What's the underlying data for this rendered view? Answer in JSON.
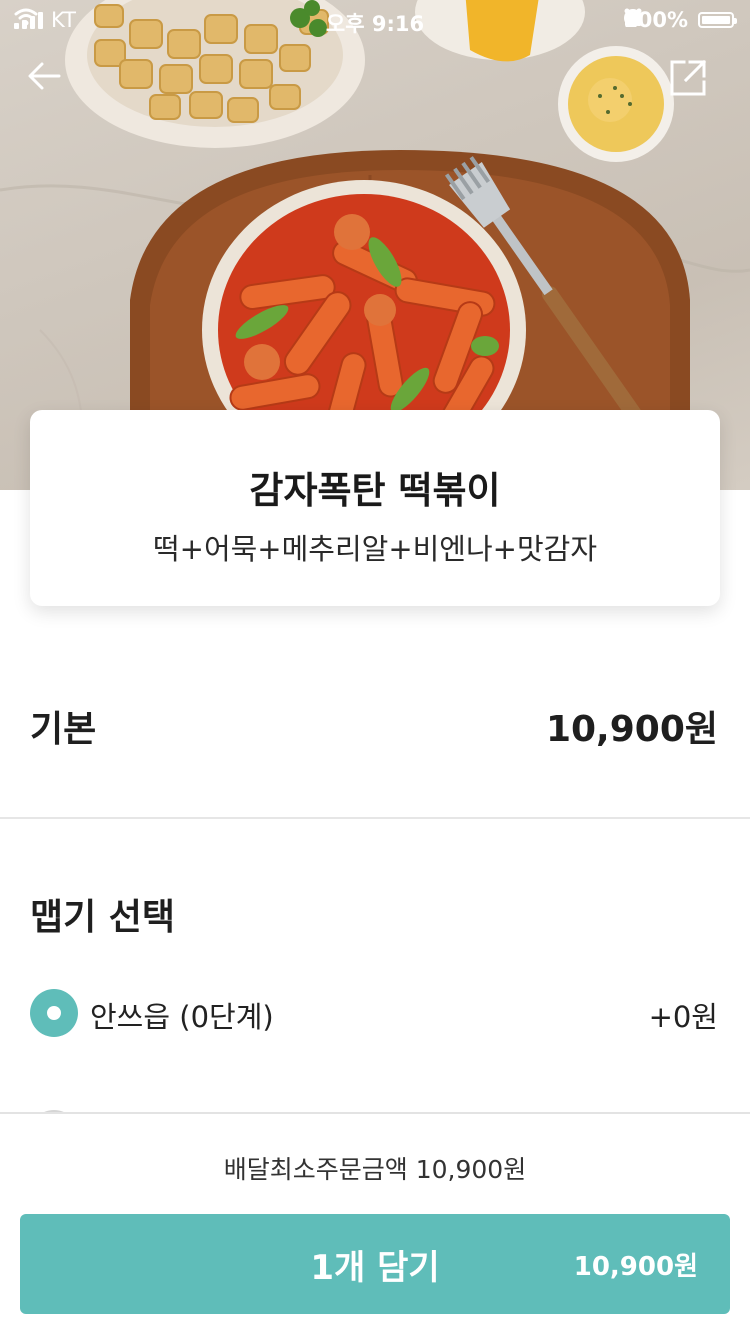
{
  "status_bar": {
    "carrier": "KT",
    "time": "오후 9:16",
    "battery": "100%"
  },
  "product": {
    "name": "감자폭탄 떡볶이",
    "description": "떡+어묵+메추리알+비엔나+맛감자"
  },
  "base": {
    "label": "기본",
    "price": "10,900원"
  },
  "spice": {
    "title": "맵기 선택",
    "options": [
      {
        "label": "안쓰읍 (0단계)",
        "price": "+0원",
        "selected": true
      },
      {
        "label": "",
        "price": "",
        "selected": false
      }
    ]
  },
  "footer": {
    "min_order": "배달최소주문금액 10,900원",
    "cart_button": "1개 담기",
    "cart_total": "10,900원"
  },
  "colors": {
    "accent": "#5fbdb9",
    "divider": "#e6e6e6"
  }
}
